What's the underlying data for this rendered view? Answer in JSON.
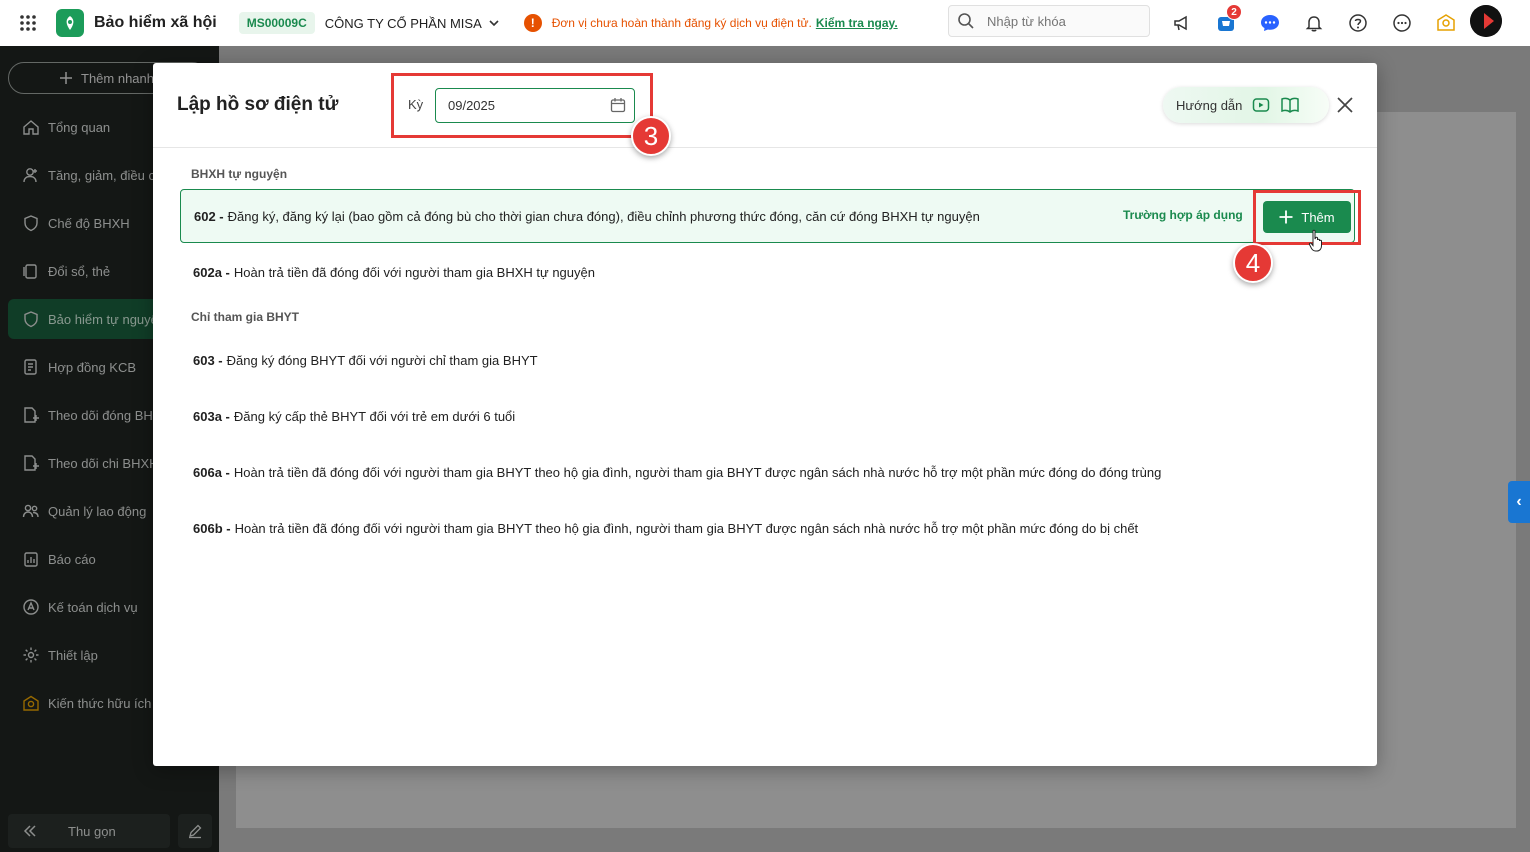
{
  "header": {
    "app_title": "Bảo hiểm xã hội",
    "company_code": "MS00009C",
    "company_name": "CÔNG TY CỔ PHẦN MISA",
    "warning_text": "Đơn vị chưa hoàn thành đăng ký dịch vụ điện tử.",
    "warning_link": "Kiểm tra ngay.",
    "search_placeholder": "Nhập từ khóa",
    "cart_badge": "2"
  },
  "sidebar": {
    "quick_add": "Thêm nhanh",
    "items": [
      {
        "label": "Tổng quan",
        "icon": "home-icon"
      },
      {
        "label": "Tăng, giảm, điều chỉnh",
        "icon": "person-icon"
      },
      {
        "label": "Chế độ BHXH",
        "icon": "shield-icon"
      },
      {
        "label": "Đổi sổ, thẻ",
        "icon": "cards-icon"
      },
      {
        "label": "Bảo hiểm tự nguyện",
        "icon": "shield-icon"
      },
      {
        "label": "Hợp đồng KCB",
        "icon": "contract-icon"
      },
      {
        "label": "Theo dõi đóng BHXH",
        "icon": "doc-add-icon"
      },
      {
        "label": "Theo dõi chi BHXH",
        "icon": "doc-add-icon"
      },
      {
        "label": "Quản lý lao động",
        "icon": "people-icon"
      },
      {
        "label": "Báo cáo",
        "icon": "report-icon"
      },
      {
        "label": "Kế toán dịch vụ",
        "icon": "accounting-icon"
      },
      {
        "label": "Thiết lập",
        "icon": "gear-icon"
      },
      {
        "label": "Kiến thức hữu ích",
        "icon": "idea-icon"
      }
    ],
    "active_index": 4,
    "collapse_label": "Thu gọn"
  },
  "modal": {
    "title": "Lập hồ sơ điện tử",
    "period_label": "Kỳ",
    "period_value": "09/2025",
    "guide_label": "Hướng dẫn",
    "step3": "3",
    "step4": "4",
    "sections": [
      {
        "label": "BHXH tự nguyện",
        "rows": [
          {
            "code": "602 -",
            "text": "Đăng ký, đăng ký lại (bao gồm cả đóng bù cho thời gian chưa đóng), điều chỉnh phương thức đóng, căn cứ đóng BHXH tự nguyện",
            "apply_link": "Trường hợp áp dụng",
            "add_label": "Thêm"
          },
          {
            "code": "602a -",
            "text": "Hoàn trả tiền đã đóng đối với người tham gia BHXH tự nguyện"
          }
        ]
      },
      {
        "label": "Chỉ tham gia BHYT",
        "rows": [
          {
            "code": "603 -",
            "text": "Đăng ký đóng BHYT đối với người chỉ tham gia BHYT"
          },
          {
            "code": "603a -",
            "text": "Đăng ký cấp thẻ BHYT đối với trẻ em dưới 6 tuổi"
          },
          {
            "code": "606a -",
            "text": "Hoàn trả tiền đã đóng đối với người tham gia BHYT theo hộ gia đình, người tham gia BHYT được ngân sách nhà nước hỗ trợ một phần mức đóng do đóng trùng"
          },
          {
            "code": "606b -",
            "text": "Hoàn trả tiền đã đóng đối với người tham gia BHYT theo hộ gia đình, người tham gia BHYT được ngân sách nhà nước hỗ trợ một phần mức đóng do bị chết"
          }
        ]
      }
    ]
  },
  "colors": {
    "brand_green": "#1a8a4e",
    "warning_orange": "#e65100",
    "highlight_red": "#e53935",
    "sidebar_bg": "#1f2421"
  }
}
